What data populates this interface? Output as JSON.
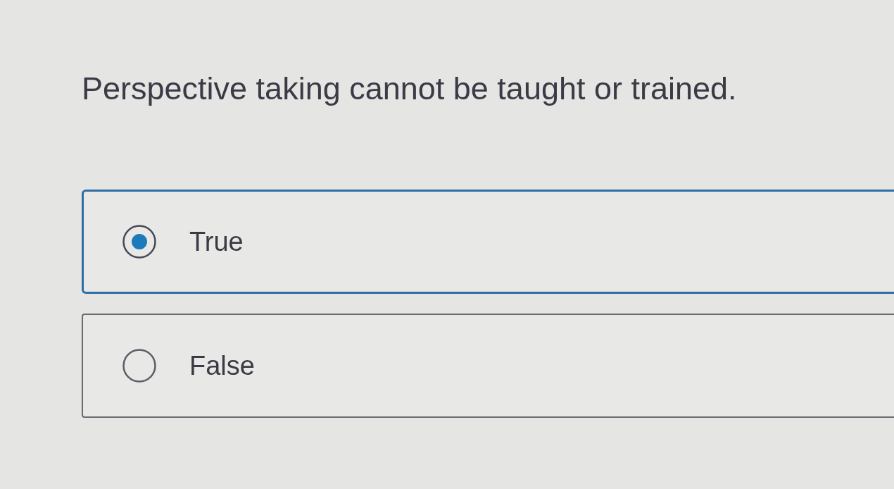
{
  "question": {
    "text": "Perspective taking cannot be taught or trained."
  },
  "options": [
    {
      "label": "True",
      "selected": true
    },
    {
      "label": "False",
      "selected": false
    }
  ]
}
